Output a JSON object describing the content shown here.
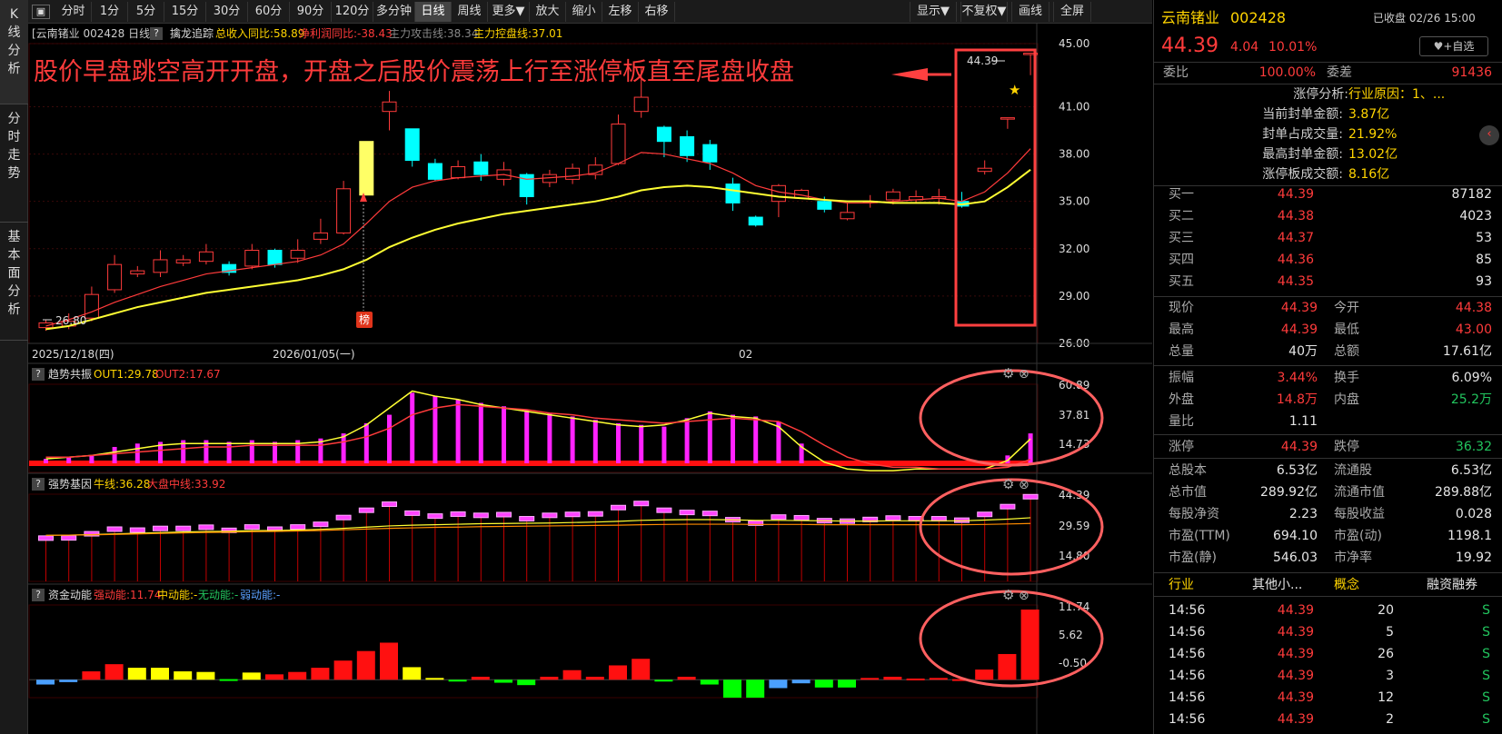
{
  "left_tabs": [
    "K线分析",
    "分时走势",
    "基本面分析"
  ],
  "toolbar": {
    "left": [
      "分时",
      "1分",
      "5分",
      "15分",
      "30分",
      "60分",
      "90分",
      "120分",
      "多分钟",
      "日线",
      "周线",
      "更多▼",
      "放大",
      "缩小",
      "左移",
      "右移"
    ],
    "active": "日线",
    "right": [
      "显示▼",
      "不复权▼",
      "画线",
      "全屏"
    ]
  },
  "info": {
    "title": "[云南锗业 002428 日线]",
    "q": "?",
    "indicator": "擒龙追踪",
    "i1": "总收入同比:58.89",
    "i2": "净利润同比:-38.43",
    "i3": "主力攻击线:38.34",
    "i4": "主力控盘线:37.01"
  },
  "annotation": "股价早盘跳空高开开盘，开盘之后股价震荡上行至涨停板直至尾盘收盘",
  "price_axis": [
    "45.00",
    "41.00",
    "38.00",
    "35.00",
    "32.00",
    "29.00",
    "26.00"
  ],
  "low_label": "26.80",
  "high_label": "44.39",
  "bang_label": "榜",
  "dates": [
    "2025/12/18(四)",
    "2026/01/05(一)",
    "02"
  ],
  "sub1": {
    "q": "?",
    "name": "趋势共振",
    "o1": "OUT1:29.78",
    "o2": "OUT2:17.67",
    "axis": [
      "60.89",
      "37.81",
      "14.73"
    ]
  },
  "sub2": {
    "q": "?",
    "name": "强势基因",
    "o1": "牛线:36.28",
    "o2": "大盘中线:33.92",
    "axis": [
      "44.39",
      "29.59",
      "14.80"
    ]
  },
  "sub3": {
    "q": "?",
    "name": "资金动能",
    "o1": "强动能:11.74",
    "o2": "中动能:-",
    "o3": "无动能:-",
    "o4": "弱动能:-",
    "axis": [
      "11.74",
      "5.62",
      "-0.50"
    ]
  },
  "chart_data": [
    {
      "type": "candlestick",
      "title": "云南锗业 002428 日线",
      "ylim": [
        26.0,
        45.0
      ],
      "x_labels": [
        "2025/12/18(四)",
        "2026/01/05(一)",
        "02"
      ],
      "candles": [
        [
          27.0,
          27.3,
          27.5,
          26.8
        ],
        [
          27.1,
          27.4,
          27.9,
          26.9
        ],
        [
          27.6,
          29.1,
          29.6,
          27.4
        ],
        [
          29.4,
          31.0,
          31.6,
          29.2
        ],
        [
          30.4,
          30.6,
          30.9,
          30.2
        ],
        [
          30.5,
          31.3,
          31.9,
          30.2
        ],
        [
          31.1,
          31.3,
          31.6,
          30.9
        ],
        [
          31.2,
          31.8,
          32.3,
          31.0
        ],
        [
          31.0,
          30.5,
          31.2,
          30.3
        ],
        [
          30.9,
          31.9,
          32.3,
          30.7
        ],
        [
          31.9,
          31.0,
          32.0,
          30.8
        ],
        [
          31.4,
          31.9,
          32.6,
          31.1
        ],
        [
          32.6,
          33.0,
          33.9,
          32.3
        ],
        [
          33.0,
          35.8,
          36.3,
          32.9
        ],
        [
          35.4,
          38.8,
          38.8,
          35.4
        ],
        [
          40.7,
          41.3,
          42.0,
          39.5
        ],
        [
          39.6,
          37.6,
          39.6,
          37.2
        ],
        [
          37.4,
          36.4,
          37.7,
          36.3
        ],
        [
          36.5,
          37.2,
          37.6,
          36.4
        ],
        [
          37.5,
          36.7,
          38.0,
          36.3
        ],
        [
          36.4,
          37.0,
          37.5,
          36.0
        ],
        [
          36.7,
          35.3,
          36.8,
          34.8
        ],
        [
          36.2,
          36.7,
          37.0,
          35.9
        ],
        [
          36.4,
          37.1,
          37.4,
          36.1
        ],
        [
          36.7,
          37.3,
          37.8,
          36.4
        ],
        [
          37.4,
          39.9,
          40.5,
          37.3
        ],
        [
          40.7,
          41.6,
          43.5,
          40.3
        ],
        [
          39.7,
          38.8,
          39.8,
          37.8
        ],
        [
          39.1,
          37.9,
          39.5,
          37.5
        ],
        [
          38.6,
          37.5,
          38.9,
          37.0
        ],
        [
          36.1,
          34.9,
          36.5,
          34.4
        ],
        [
          34.0,
          33.5,
          34.1,
          33.4
        ],
        [
          35.0,
          36.0,
          36.1,
          34.0
        ],
        [
          35.2,
          35.7,
          35.8,
          35.2
        ],
        [
          35.0,
          34.5,
          35.3,
          34.3
        ],
        [
          33.9,
          34.3,
          34.9,
          33.8
        ],
        [
          35.0,
          35.0,
          35.4,
          34.6
        ],
        [
          35.1,
          35.6,
          35.8,
          34.8
        ],
        [
          35.1,
          35.3,
          35.7,
          34.9
        ],
        [
          35.2,
          35.3,
          35.8,
          34.8
        ],
        [
          35.0,
          34.7,
          35.6,
          34.6
        ],
        [
          36.9,
          37.1,
          37.6,
          36.7
        ],
        [
          40.3,
          40.3,
          40.3,
          39.6
        ],
        [
          44.39,
          44.39,
          44.39,
          43.0
        ]
      ],
      "series": [
        {
          "name": "主力攻击线",
          "values": [
            27.1,
            27.5,
            28.0,
            28.6,
            29.1,
            29.6,
            30.0,
            30.4,
            30.6,
            30.8,
            31.0,
            31.2,
            31.6,
            32.3,
            33.6,
            35.0,
            35.9,
            36.3,
            36.5,
            36.6,
            36.7,
            36.4,
            36.5,
            36.6,
            36.8,
            37.4,
            38.1,
            38.0,
            37.7,
            37.4,
            36.8,
            36.0,
            35.6,
            35.4,
            35.1,
            34.9,
            34.9,
            35.0,
            35.1,
            35.2,
            35.0,
            35.6,
            36.8,
            38.34
          ]
        },
        {
          "name": "主力控盘线",
          "values": [
            26.9,
            27.1,
            27.5,
            27.9,
            28.3,
            28.6,
            28.9,
            29.2,
            29.4,
            29.6,
            29.8,
            30.0,
            30.3,
            30.7,
            31.3,
            32.1,
            32.7,
            33.2,
            33.6,
            33.9,
            34.2,
            34.4,
            34.6,
            34.8,
            35.0,
            35.3,
            35.7,
            35.9,
            36.0,
            35.9,
            35.7,
            35.5,
            35.3,
            35.2,
            35.1,
            35.0,
            35.0,
            34.9,
            34.9,
            34.9,
            34.8,
            35.0,
            35.9,
            37.01
          ]
        }
      ]
    },
    {
      "type": "bar",
      "title": "趋势共振",
      "ylim": [
        10,
        62
      ],
      "values": [
        18,
        19,
        20,
        25,
        27,
        28,
        29,
        29,
        28,
        29,
        28,
        29,
        30,
        33,
        39,
        44,
        57,
        55,
        53,
        51,
        49,
        47,
        45,
        43,
        41,
        39,
        38,
        37,
        42,
        46,
        44,
        43,
        40,
        27,
        15,
        14,
        14,
        14,
        14,
        14,
        14,
        14,
        20,
        33
      ],
      "series": [
        {
          "name": "OUT1",
          "values": [
            18,
            19,
            20,
            22,
            24,
            26,
            27,
            27,
            27,
            27,
            27,
            27,
            28,
            31,
            38,
            48,
            58,
            55,
            53,
            50,
            48,
            46,
            44,
            42,
            40,
            38,
            37,
            38,
            41,
            45,
            43,
            42,
            37,
            25,
            16,
            12,
            11,
            11,
            12,
            12,
            12,
            12,
            17,
            29.78
          ]
        },
        {
          "name": "OUT2",
          "values": [
            19,
            19,
            20,
            21,
            22,
            23,
            24,
            25,
            25,
            26,
            26,
            26,
            26,
            28,
            31,
            36,
            44,
            48,
            50,
            49,
            48,
            47,
            45,
            44,
            42,
            41,
            40,
            39,
            40,
            41,
            42,
            41,
            40,
            34,
            26,
            19,
            15,
            13,
            13,
            12,
            12,
            12,
            13,
            17.67
          ]
        }
      ]
    },
    {
      "type": "bar",
      "title": "强势基因",
      "ylim": [
        10,
        46
      ],
      "values": [
        27.3,
        27.4,
        29.1,
        31.0,
        30.6,
        31.3,
        31.3,
        31.8,
        30.5,
        31.9,
        31.0,
        31.9,
        33.0,
        35.8,
        38.8,
        41.3,
        37.6,
        36.4,
        37.2,
        36.7,
        37.0,
        35.3,
        36.7,
        37.1,
        37.3,
        39.9,
        41.6,
        38.8,
        37.9,
        37.5,
        34.9,
        33.5,
        36.0,
        35.7,
        34.5,
        34.3,
        35.0,
        35.6,
        35.3,
        35.3,
        34.7,
        37.1,
        40.3,
        44.39
      ],
      "series": [
        {
          "name": "牛线",
          "values": [
            29.0,
            29.1,
            29.3,
            29.6,
            29.9,
            30.1,
            30.4,
            30.6,
            30.7,
            30.9,
            31.0,
            31.2,
            31.5,
            31.9,
            32.4,
            32.9,
            33.2,
            33.4,
            33.6,
            33.8,
            33.9,
            34.0,
            34.1,
            34.3,
            34.5,
            34.8,
            35.2,
            35.4,
            35.5,
            35.5,
            35.4,
            35.2,
            35.2,
            35.1,
            35.0,
            34.9,
            34.9,
            35.0,
            35.0,
            35.0,
            35.0,
            35.3,
            35.7,
            36.28
          ]
        },
        {
          "name": "大盘中线",
          "values": [
            29.0,
            29.1,
            29.2,
            29.4,
            29.6,
            29.8,
            30.0,
            30.2,
            30.3,
            30.5,
            30.6,
            30.8,
            31.0,
            31.3,
            31.6,
            31.9,
            32.1,
            32.3,
            32.4,
            32.6,
            32.7,
            32.8,
            32.9,
            33.0,
            33.1,
            33.2,
            33.4,
            33.5,
            33.6,
            33.6,
            33.6,
            33.5,
            33.5,
            33.5,
            33.4,
            33.4,
            33.4,
            33.4,
            33.4,
            33.4,
            33.4,
            33.5,
            33.7,
            33.92
          ]
        }
      ]
    },
    {
      "type": "bar",
      "title": "资金动能",
      "ylim": [
        -3.0,
        12.5
      ],
      "values": [
        -0.8,
        -0.4,
        1.4,
        2.6,
        2.0,
        2.0,
        1.4,
        1.3,
        0.1,
        1.2,
        0.9,
        1.3,
        2.0,
        3.2,
        4.8,
        6.2,
        2.1,
        0.3,
        -0.2,
        0.5,
        -0.5,
        -0.9,
        0.5,
        1.6,
        0.5,
        2.4,
        3.5,
        -0.3,
        0.5,
        -0.8,
        -3.0,
        -3.0,
        -1.4,
        -0.6,
        -1.3,
        -1.3,
        0.3,
        0.5,
        0.2,
        0.3,
        0.1,
        1.7,
        4.3,
        11.74
      ],
      "colors": [
        "blue",
        "blue",
        "red",
        "red",
        "yellow",
        "yellow",
        "yellow",
        "yellow",
        "green",
        "yellow",
        "red",
        "red",
        "red",
        "red",
        "red",
        "red",
        "yellow",
        "yellow",
        "green",
        "red",
        "green",
        "green",
        "red",
        "red",
        "red",
        "red",
        "red",
        "green",
        "red",
        "green",
        "green",
        "green",
        "blue",
        "blue",
        "green",
        "green",
        "red",
        "red",
        "red",
        "red",
        "red",
        "red",
        "red",
        "red"
      ]
    }
  ],
  "right": {
    "name": "云南锗业",
    "code": "002428",
    "status": "已收盘 02/26 15:00",
    "price": "44.39",
    "change": "4.04",
    "pct": "10.01%",
    "watch": "+自选",
    "weibi_l": "委比",
    "weibi_v": "100.00%",
    "weicha_l": "委差",
    "weicha_v": "91436",
    "analysis": [
      {
        "l": "涨停分析:",
        "v": "行业原因：1、..."
      },
      {
        "l": "当前封单金额:",
        "v": "3.87亿"
      },
      {
        "l": "封单占成交量:",
        "v": "21.92%"
      },
      {
        "l": "最高封单金额:",
        "v": "13.02亿"
      },
      {
        "l": "涨停板成交额:",
        "v": "8.16亿"
      }
    ],
    "bids": [
      {
        "l": "买一",
        "p": "44.39",
        "v": "87182"
      },
      {
        "l": "买二",
        "p": "44.38",
        "v": "4023"
      },
      {
        "l": "买三",
        "p": "44.37",
        "v": "53"
      },
      {
        "l": "买四",
        "p": "44.36",
        "v": "85"
      },
      {
        "l": "买五",
        "p": "44.35",
        "v": "93"
      }
    ],
    "stats1": [
      [
        "现价",
        "44.39",
        "今开",
        "44.38"
      ],
      [
        "最高",
        "44.39",
        "最低",
        "43.00"
      ],
      [
        "总量",
        "40万",
        "总额",
        "17.61亿"
      ]
    ],
    "stats2": [
      [
        "振幅",
        "3.44%",
        "换手",
        "6.09%"
      ],
      [
        "外盘",
        "14.8万",
        "内盘",
        "25.2万"
      ],
      [
        "量比",
        "1.11",
        "",
        ""
      ]
    ],
    "limits": [
      "涨停",
      "44.39",
      "跌停",
      "36.32"
    ],
    "stats3": [
      [
        "总股本",
        "6.53亿",
        "流通股",
        "6.53亿"
      ],
      [
        "总市值",
        "289.92亿",
        "流通市值",
        "289.88亿"
      ],
      [
        "每股净资",
        "2.23",
        "每股收益",
        "0.028"
      ],
      [
        "市盈(TTM)",
        "694.10",
        "市盈(动)",
        "1198.1"
      ],
      [
        "市盈(静)",
        "546.03",
        "市净率",
        "19.92"
      ]
    ],
    "industry": [
      "行业",
      "其他小...",
      "概念",
      "融资融券"
    ],
    "ticks": [
      {
        "t": "14:56",
        "p": "44.39",
        "v": "20",
        "s": "S"
      },
      {
        "t": "14:56",
        "p": "44.39",
        "v": "5",
        "s": "S"
      },
      {
        "t": "14:56",
        "p": "44.39",
        "v": "26",
        "s": "S"
      },
      {
        "t": "14:56",
        "p": "44.39",
        "v": "3",
        "s": "S"
      },
      {
        "t": "14:56",
        "p": "44.39",
        "v": "12",
        "s": "S"
      },
      {
        "t": "14:56",
        "p": "44.39",
        "v": "2",
        "s": "S"
      }
    ]
  }
}
